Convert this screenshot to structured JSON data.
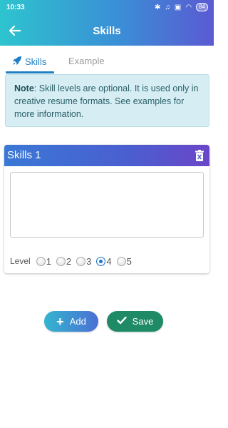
{
  "status_bar": {
    "time": "10:33",
    "icons": [
      "bluetooth-icon",
      "mute-icon",
      "sim-icon",
      "wifi-icon"
    ],
    "battery": "84"
  },
  "app_bar": {
    "title": "Skills",
    "back_icon": "back-arrow-icon"
  },
  "tabs": [
    {
      "label": "Skills",
      "icon": "rocket-icon",
      "active": true
    },
    {
      "label": "Example",
      "active": false
    }
  ],
  "note": {
    "bold": "Note",
    "text": ": Skill levels are optional. It is used only in creative resume formats. See examples for more information."
  },
  "skill_card": {
    "title": "Skills 1",
    "value": "",
    "placeholder": "",
    "level_label": "Level",
    "levels": [
      "1",
      "2",
      "3",
      "4",
      "5"
    ],
    "selected_level": "4"
  },
  "buttons": {
    "add_label": "Add",
    "save_label": "Save"
  },
  "colors": {
    "accent_blue": "#1f7fc2",
    "save_green": "#1e8a66",
    "note_bg": "#d6eef3"
  }
}
